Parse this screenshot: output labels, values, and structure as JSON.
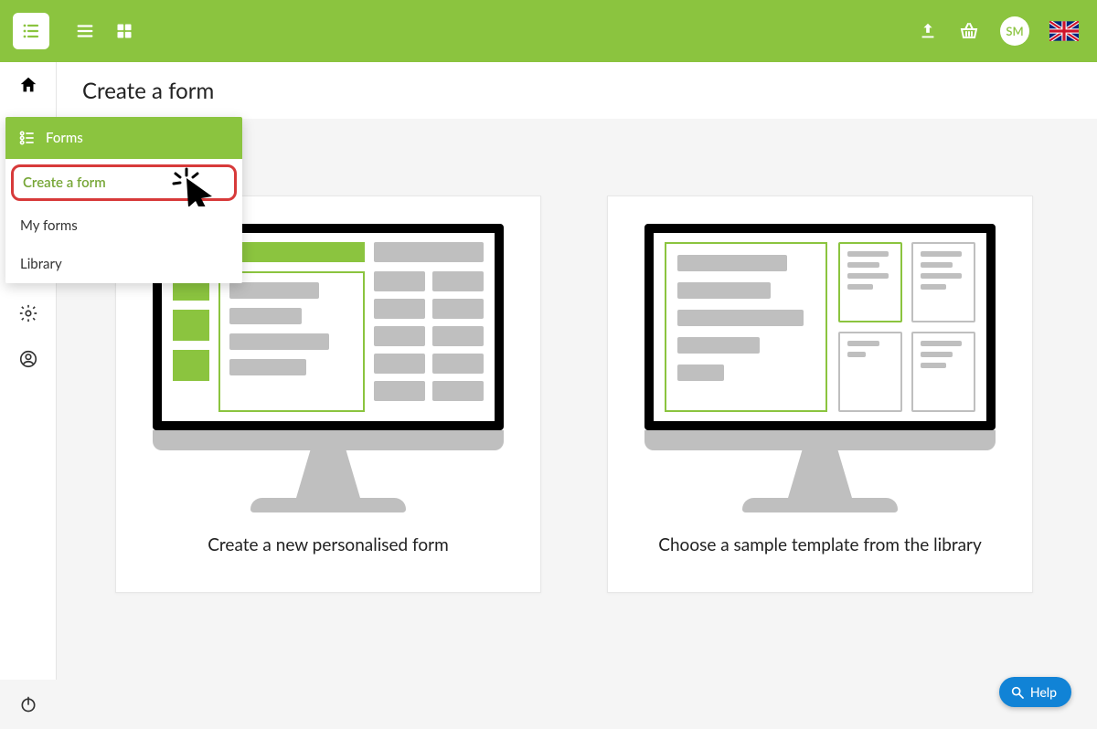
{
  "header": {
    "avatar_initials": "SM"
  },
  "page": {
    "title": "Create a form"
  },
  "sidebar_flyout": {
    "header_label": "Forms",
    "items": [
      {
        "label": "Create a form"
      },
      {
        "label": "My forms"
      },
      {
        "label": "Library"
      }
    ]
  },
  "cards": {
    "create": {
      "caption": "Create a new personalised form"
    },
    "library": {
      "caption": "Choose a sample template from the library"
    }
  },
  "help": {
    "label": "Help"
  }
}
